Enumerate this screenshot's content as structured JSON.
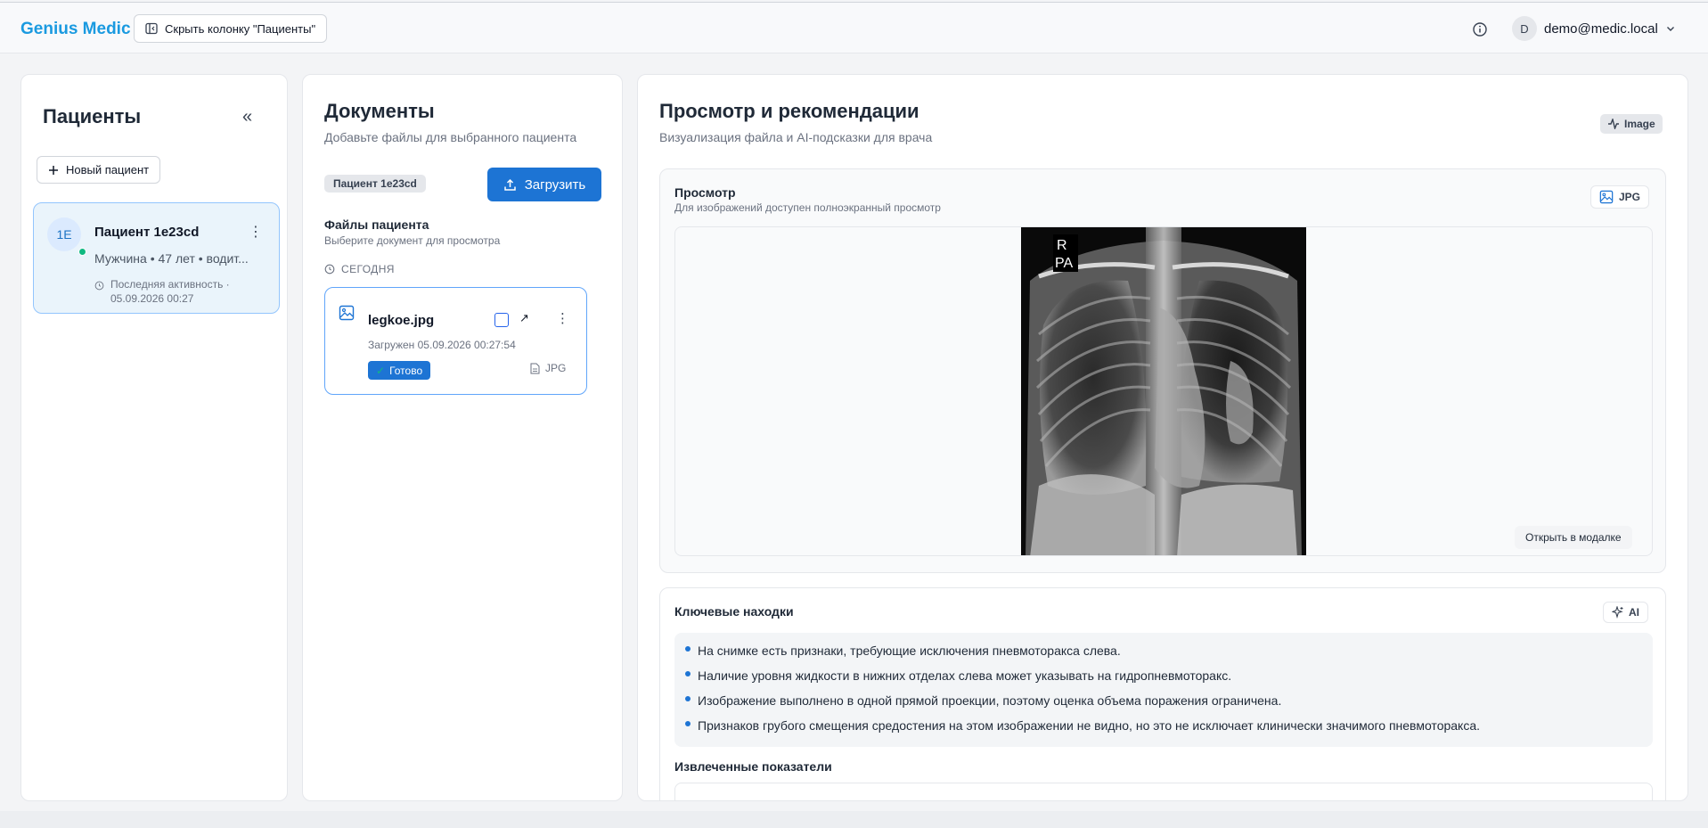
{
  "header": {
    "brand": "Genius Medic",
    "hide_column_label": "Скрыть колонку \"Пациенты\"",
    "user_initial": "D",
    "user_email": "demo@medic.local"
  },
  "patients_panel": {
    "title": "Пациенты",
    "collapse_label": "«",
    "new_patient_label": "Новый пациент",
    "patients": [
      {
        "initials": "1E",
        "name": "Пациент 1e23cd",
        "meta": "Мужчина • 47 лет • водит...",
        "activity_line1": "Последняя активность ·",
        "activity_line2": "05.09.2026 00:27",
        "online": true
      }
    ]
  },
  "documents_panel": {
    "title": "Документы",
    "subtitle": "Добавьте файлы для выбранного пациента",
    "patient_pill": "Пациент 1e23cd",
    "upload_label": "Загрузить",
    "files_title": "Файлы пациента",
    "files_subtitle": "Выберите документ для просмотра",
    "group_label": "СЕГОДНЯ",
    "files": [
      {
        "name": "legkoe.jpg",
        "uploaded": "Загружен 05.09.2026 00:27:54",
        "status": "Готово",
        "type": "JPG"
      }
    ]
  },
  "view_panel": {
    "title": "Просмотр и рекомендации",
    "subtitle": "Визуализация файла и AI-подсказки для врача",
    "kind_badge": "Image",
    "preview": {
      "title": "Просмотр",
      "subtitle": "Для изображений доступен полноэкранный просмотр",
      "format_badge": "JPG",
      "xray_marker_r": "R",
      "xray_marker_pa": "PA",
      "open_modal_label": "Открыть в модалке"
    },
    "findings": {
      "title": "Ключевые находки",
      "ai_badge": "AI",
      "items": [
        "На снимке есть признаки, требующие исключения пневмоторакса слева.",
        "Наличие уровня жидкости в нижних отделах слева может указывать на гидропневмоторакс.",
        "Изображение выполнено в одной прямой проекции, поэтому оценка объема поражения ограничена.",
        "Признаков грубого смещения средостения на этом изображении не видно, но это не исключает клинически значимого пневмоторакса."
      ]
    },
    "extracted_title": "Извлеченные показатели"
  },
  "colors": {
    "brand": "#1a9ae0",
    "primary": "#1d74d4",
    "online": "#10b981"
  }
}
